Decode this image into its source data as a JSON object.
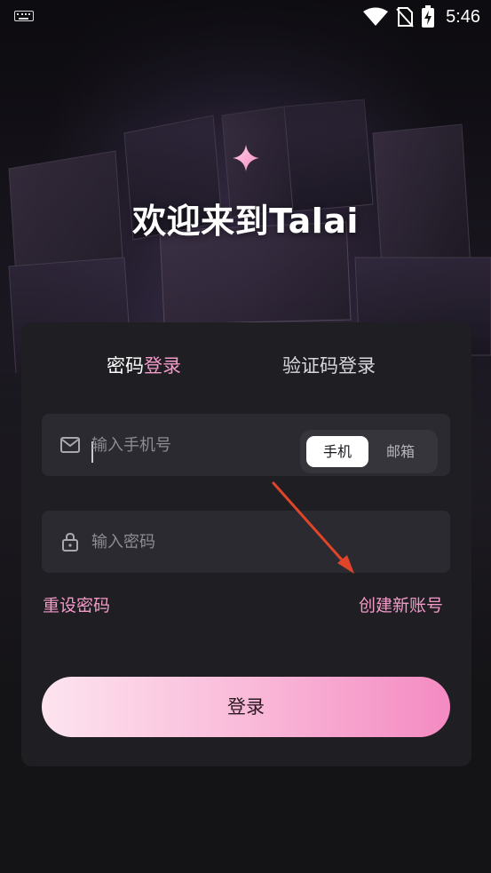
{
  "status_bar": {
    "time": "5:46",
    "icons": [
      "keyboard-icon",
      "wifi-icon",
      "no-sim-icon",
      "battery-charging-icon"
    ]
  },
  "hero": {
    "title": "欢迎来到Talai",
    "icon": "sparkle-icon"
  },
  "tabs": {
    "password_login_part1": "密码",
    "password_login_part2": "登录",
    "code_login": "验证码登录"
  },
  "phone_field": {
    "placeholder": "输入手机号",
    "value": "",
    "icon": "mail-icon",
    "toggle": {
      "phone": "手机",
      "email": "邮箱",
      "selected": "手机"
    }
  },
  "password_field": {
    "placeholder": "输入密码",
    "value": "",
    "icon": "lock-icon"
  },
  "links": {
    "reset_password": "重设密码",
    "create_account": "创建新账号"
  },
  "login_button": {
    "label": "登录"
  },
  "colors": {
    "accent_pink": "#f39ac8",
    "card_bg": "#1f1e23",
    "field_bg": "#2b2a30",
    "annotation_arrow": "#e0452a"
  }
}
